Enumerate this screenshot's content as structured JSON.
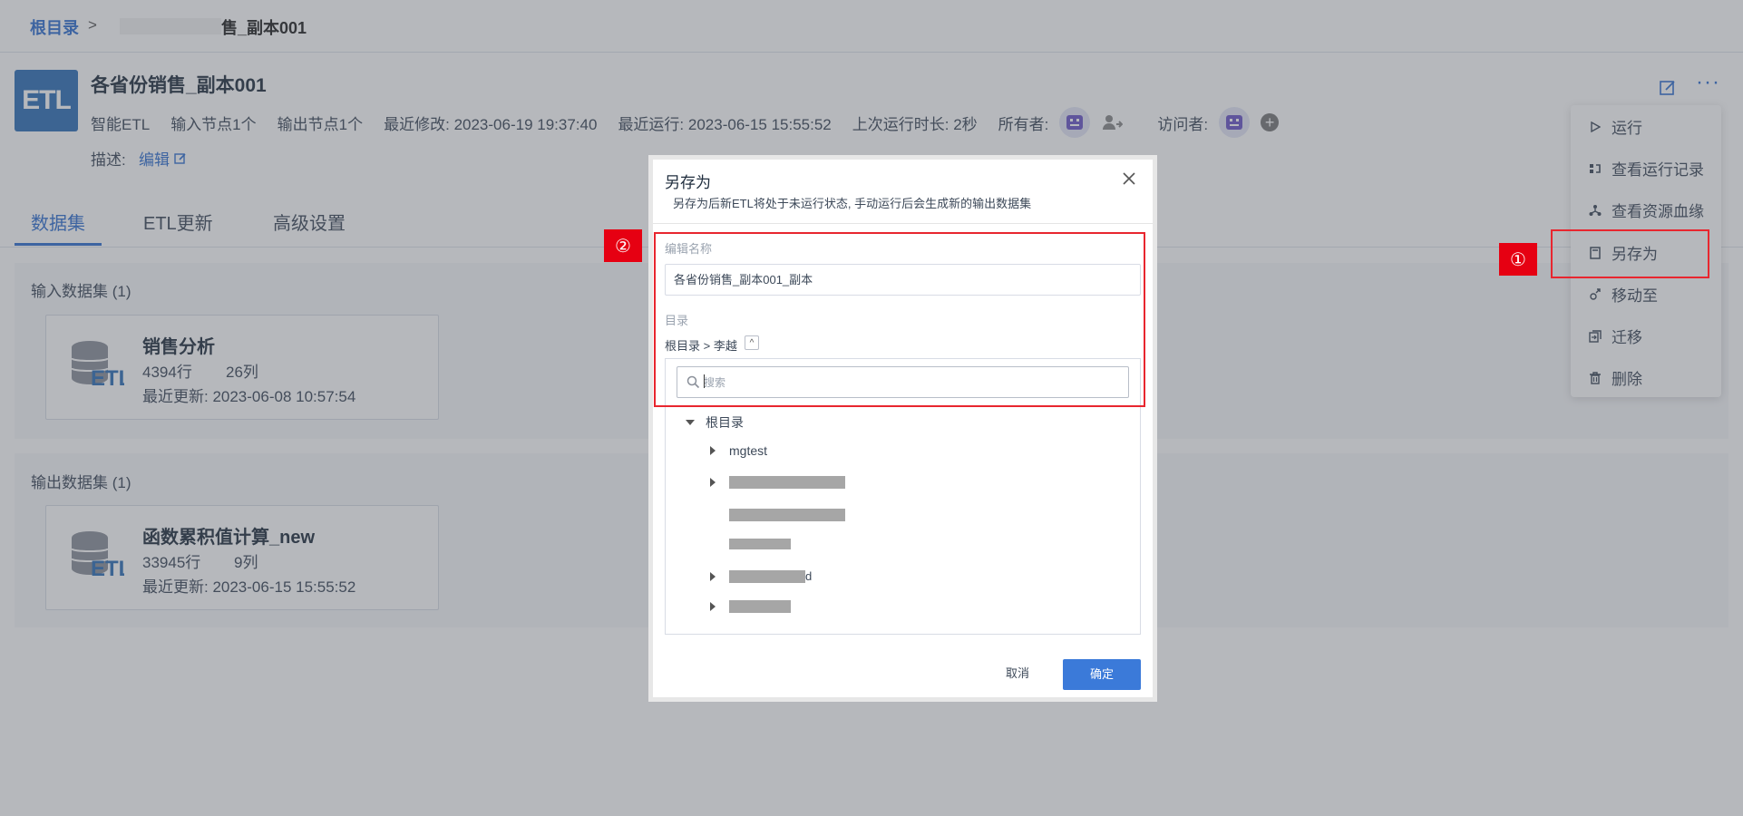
{
  "breadcrumb": {
    "root": "根目录",
    "separator": ">",
    "current": "售_副本001"
  },
  "header": {
    "logo_text": "ETL",
    "title": "各省份销售_副本001",
    "type": "智能ETL",
    "input_nodes": "输入节点1个",
    "output_nodes": "输出节点1个",
    "last_modified": "最近修改: 2023-06-19 19:37:40",
    "last_run": "最近运行: 2023-06-15 15:55:52",
    "last_duration": "上次运行时长: 2秒",
    "owner_label": "所有者:",
    "visitor_label": "访问者:",
    "desc_label": "描述:",
    "desc_edit": "编辑"
  },
  "tabs": [
    {
      "label": "数据集",
      "active": true
    },
    {
      "label": "ETL更新",
      "active": false
    },
    {
      "label": "高级设置",
      "active": false
    }
  ],
  "input_section": {
    "title": "输入数据集 (1)",
    "card": {
      "icon_label": "ETL",
      "name": "销售分析",
      "rows": "4394行",
      "cols": "26列",
      "updated": "最近更新: 2023-06-08 10:57:54"
    }
  },
  "output_section": {
    "title": "输出数据集 (1)",
    "card": {
      "icon_label": "ETL",
      "name": "函数累积值计算_new",
      "rows": "33945行",
      "cols": "9列",
      "updated": "最近更新: 2023-06-15 15:55:52"
    }
  },
  "menu": {
    "items": [
      {
        "label": "运行",
        "icon": "play-icon"
      },
      {
        "label": "查看运行记录",
        "icon": "history-icon"
      },
      {
        "label": "查看资源血缘",
        "icon": "lineage-icon"
      },
      {
        "label": "另存为",
        "icon": "save-as-icon"
      },
      {
        "label": "移动至",
        "icon": "move-icon"
      },
      {
        "label": "迁移",
        "icon": "migrate-icon"
      },
      {
        "label": "删除",
        "icon": "trash-icon"
      }
    ]
  },
  "dialog": {
    "title": "另存为",
    "subtitle": "另存为后新ETL将处于未运行状态, 手动运行后会生成新的输出数据集",
    "name_label": "编辑名称",
    "name_value": "各省份销售_副本001_副本",
    "dir_label": "目录",
    "dir_path": "根目录 > 李越",
    "search_placeholder": "搜索",
    "tree": {
      "root": "根目录",
      "children": [
        "mgtest",
        "",
        "",
        "",
        "d",
        ""
      ]
    },
    "cancel_label": "取消",
    "ok_label": "确定"
  },
  "annotations": {
    "badge1": "①",
    "badge2": "②"
  },
  "colors": {
    "accent": "#2f6fd0",
    "primary_button": "#3b7ad9",
    "annotation_red": "#e60012"
  }
}
